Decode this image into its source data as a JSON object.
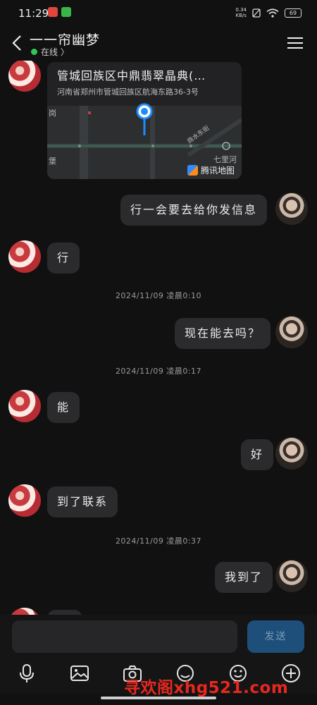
{
  "status_bar": {
    "time": "11:29",
    "net_speed_top": "0.34",
    "net_speed_unit": "KB/s",
    "battery": "69"
  },
  "header": {
    "contact_name": "一一帘幽梦",
    "online_status": "在线 〉",
    "online_color": "#2fc65a"
  },
  "location_card": {
    "title": "管城回族区中鼎翡翠晶典(…",
    "address": "河南省郑州市管城回族区航海东路36-3号",
    "map_labels": [
      "岗",
      "七里河",
      "堡",
      "商水东街"
    ],
    "brand": "腾讯地图"
  },
  "messages": [
    {
      "side": "me",
      "text": "行一会要去给你发信息"
    },
    {
      "side": "her",
      "text": "行"
    },
    {
      "type": "time",
      "text": "2024/11/09 凌晨0:10"
    },
    {
      "side": "me",
      "text": "现在能去吗？"
    },
    {
      "type": "time",
      "text": "2024/11/09 凌晨0:17"
    },
    {
      "side": "her",
      "text": "能"
    },
    {
      "side": "me",
      "text": "好"
    },
    {
      "side": "her",
      "text": "到了联系"
    },
    {
      "type": "time",
      "text": "2024/11/09 凌晨0:37"
    },
    {
      "side": "me",
      "text": "我到了"
    }
  ],
  "composer": {
    "send_label": "发送"
  },
  "toolbar": [
    "microphone-icon",
    "image-icon",
    "camera-icon",
    "sticker-icon",
    "emoji-icon",
    "plus-icon"
  ],
  "watermark": "寻欢阁xhg521.com",
  "colors": {
    "background": "#111112",
    "bubble": "#2b2b2d",
    "send_button": "#1d4f7a",
    "map_pin": "#1e8cff"
  }
}
